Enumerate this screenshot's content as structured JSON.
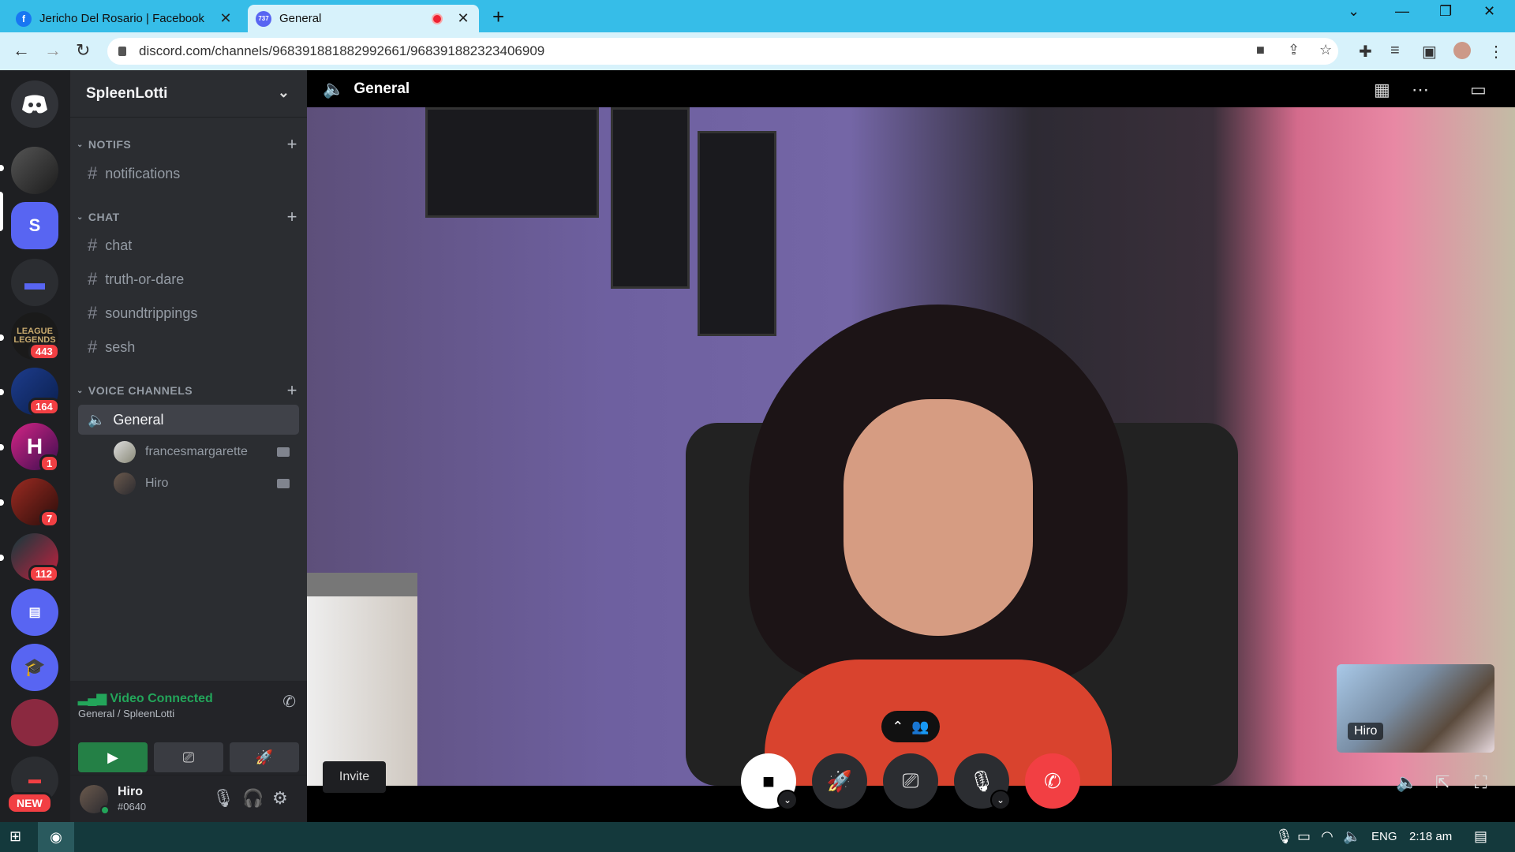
{
  "browser": {
    "tabs": [
      {
        "title": "Jericho Del Rosario | Facebook",
        "favicon": "facebook-icon"
      },
      {
        "title": "General",
        "favicon": "discord-icon",
        "favicon_badge": "737"
      }
    ],
    "url": "discord.com/channels/968391881882992661/968391882323406909"
  },
  "guilds": {
    "badges": [
      "443",
      "164",
      "1",
      "7",
      "112"
    ],
    "server_letter": "S",
    "league_text": "LEAGUE LEGENDS",
    "new_label": "NEW"
  },
  "sidebar": {
    "server_name": "SpleenLotti",
    "categories": [
      {
        "name": "NOTIFS"
      },
      {
        "name": "CHAT"
      },
      {
        "name": "VOICE CHANNELS"
      }
    ],
    "notifs_channels": [
      "notifications"
    ],
    "chat_channels": [
      "chat",
      "truth-or-dare",
      "soundtrippings",
      "sesh"
    ],
    "voice_channel": "General",
    "voice_users": [
      "francesmargarette",
      "Hiro"
    ]
  },
  "rtc": {
    "status": "Video Connected",
    "location": "General / SpleenLotti"
  },
  "user": {
    "name": "Hiro",
    "tag": "#0640"
  },
  "stage": {
    "title": "General",
    "self_view_label": "Hiro",
    "invite_label": "Invite"
  },
  "taskbar": {
    "lang": "ENG",
    "time": "2:18 am"
  },
  "colors": {
    "tab_bar": "#36bde8",
    "discord_green": "#23a55a",
    "discord_red": "#f23f43"
  }
}
